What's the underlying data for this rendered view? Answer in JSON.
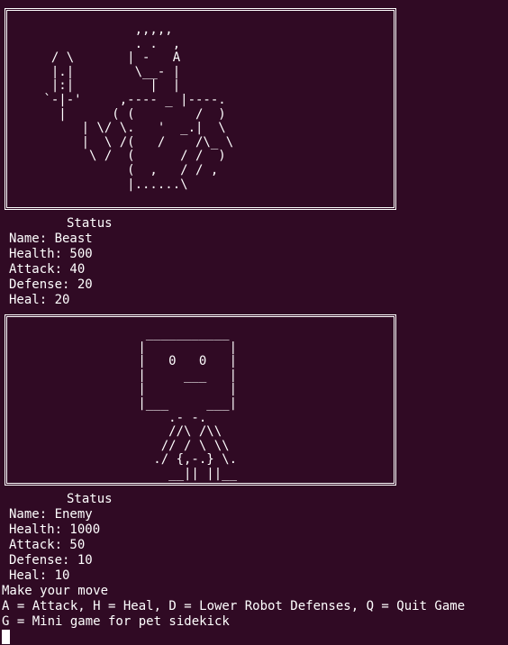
{
  "beast": {
    "art": "             ,,,,,\n             . .  ,\n  / \\       | -   A\n  |.|        \\__- |\n  |:|          |  |\n `-|-'     ,---- _ |----.\n   |      ( (        /  )\n      | \\/ \\.   '  _.|  \\\n      |  \\ /(   /    /\\_ \\\n       \\ /  (      / /  )\n            (  ,   / / ,\n            |......\\",
    "status_heading": "Status",
    "name": "Name: Beast",
    "health": "Health: 500",
    "attack": "Attack: 40",
    "defense": "Defense: 20",
    "heal": "Heal: 20"
  },
  "enemy": {
    "art": "  ___________\n |           |\n |   0   0   |\n |     ___   |\n |           |\n |___     ___|\n     .- -.\n     //\\ /\\\\\n    // / \\ \\\\\n   ./ {,-.} \\.\n     __|| ||__",
    "status_heading": "Status",
    "name": "Name: Enemy",
    "health": "Health: 1000",
    "attack": "Attack: 50",
    "defense": "Defense: 10",
    "heal": "Heal: 10"
  },
  "prompt": {
    "line1": "Make your move",
    "line2": "A = Attack, H = Heal, D = Lower Robot Defenses, Q = Quit Game",
    "line3": "G = Mini game for pet sidekick"
  },
  "colors": {
    "background": "#300a24",
    "foreground": "#ffffff"
  }
}
